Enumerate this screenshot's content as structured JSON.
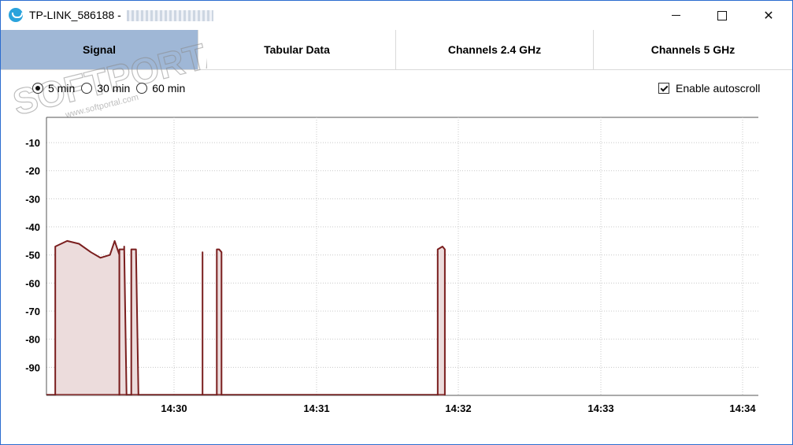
{
  "window": {
    "title": "TP-LINK_586188 -",
    "controls": {
      "minimize_icon": "minimize-icon",
      "maximize_icon": "maximize-icon",
      "close_label": "✕"
    }
  },
  "tabs": [
    {
      "label": "Signal",
      "active": true
    },
    {
      "label": "Tabular Data",
      "active": false
    },
    {
      "label": "Channels 2.4 GHz",
      "active": false
    },
    {
      "label": "Channels 5 GHz",
      "active": false
    }
  ],
  "time_range": {
    "options": [
      "5 min",
      "30 min",
      "60 min"
    ],
    "selected": "5 min"
  },
  "autoscroll": {
    "label": "Enable autoscroll",
    "checked": true
  },
  "watermark": {
    "text": "SOFTPORTAL",
    "url": "www.softportal.com"
  },
  "colors": {
    "line": "#7a1e1e",
    "fill": "#ecdcdc",
    "grid": "#c8c8c8",
    "active_tab": "#9fb7d6",
    "window_border": "#2b6ccf"
  },
  "chart_data": {
    "type": "area",
    "title": "",
    "xlabel": "",
    "ylabel": "",
    "x_ticks": [
      "14:30",
      "14:31",
      "14:32",
      "14:33",
      "14:34"
    ],
    "y_ticks": [
      -10,
      -20,
      -30,
      -40,
      -50,
      -60,
      -70,
      -80,
      -90
    ],
    "ylim": [
      -100,
      -1
    ],
    "x_range_minutes": [
      14.4,
      14.57
    ],
    "grid": true,
    "series": [
      {
        "points": [
          [
            "14:29:10",
            -47
          ],
          [
            "14:29:15",
            -45
          ],
          [
            "14:29:20",
            -46
          ],
          [
            "14:29:25",
            -49
          ],
          [
            "14:29:29",
            -51
          ],
          [
            "14:29:33",
            -50
          ],
          [
            "14:29:35",
            -45
          ],
          [
            "14:29:37",
            -50
          ],
          [
            "14:29:37",
            -100
          ],
          [
            "14:29:37",
            -100
          ],
          [
            "14:29:37",
            -100
          ]
        ]
      },
      {
        "points": [
          [
            "14:29:37",
            -48
          ],
          [
            "14:29:39",
            -48
          ],
          [
            "14:29:39",
            -47
          ],
          [
            "14:29:40",
            -100
          ]
        ]
      },
      {
        "points": [
          [
            "14:29:42",
            -48
          ],
          [
            "14:29:44",
            -48
          ],
          [
            "14:29:45",
            -100
          ]
        ]
      },
      {
        "points": [
          [
            "14:30:12",
            -49
          ],
          [
            "14:30:12",
            -100
          ]
        ]
      },
      {
        "points": [
          [
            "14:30:18",
            -48
          ],
          [
            "14:30:19",
            -48
          ],
          [
            "14:30:20",
            -49
          ],
          [
            "14:30:20",
            -100
          ]
        ]
      },
      {
        "points": [
          [
            "14:31:51",
            -48
          ],
          [
            "14:31:53",
            -47
          ],
          [
            "14:31:54",
            -48
          ],
          [
            "14:31:54",
            -100
          ]
        ]
      }
    ]
  }
}
